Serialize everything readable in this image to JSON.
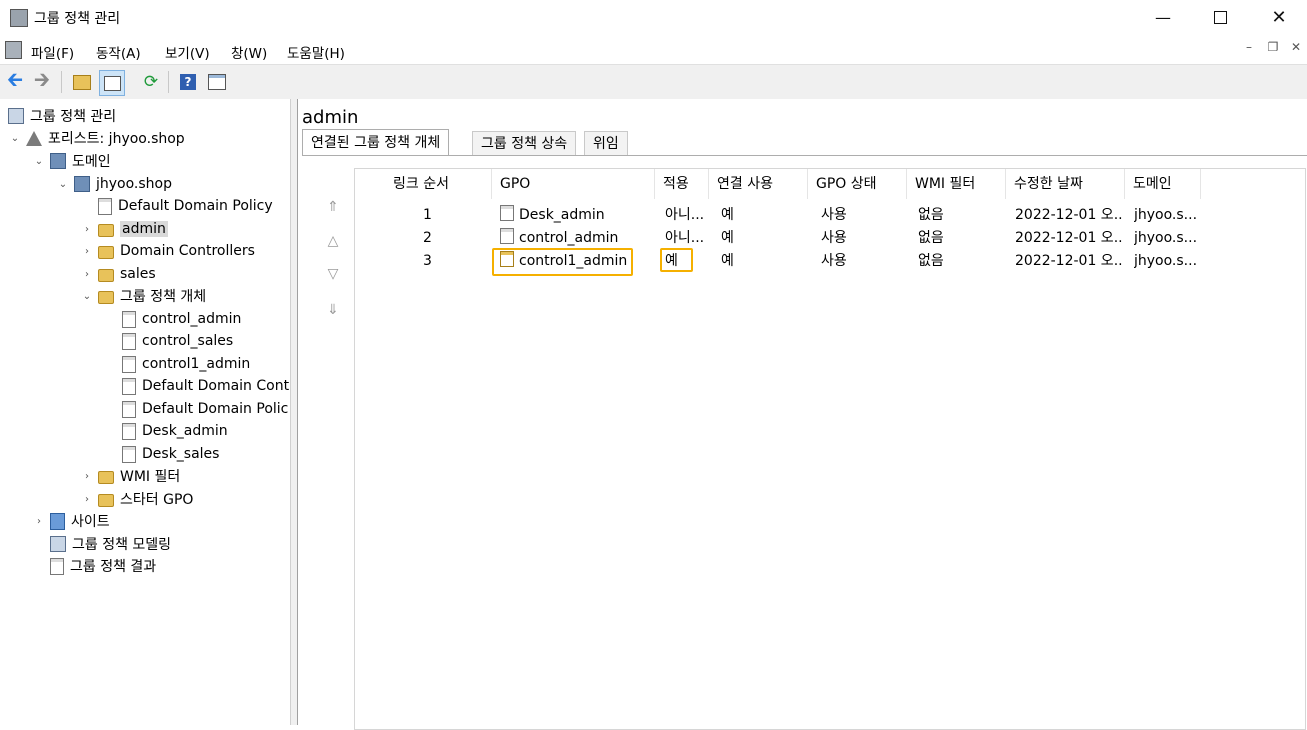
{
  "window": {
    "title": "그룹 정책 관리",
    "icon": "gpmc-app-icon",
    "controls": [
      "minimize-icon",
      "maximize-icon",
      "close-icon"
    ]
  },
  "menu": {
    "items": [
      "파일(F)",
      "동작(A)",
      "보기(V)",
      "창(W)",
      "도움말(H)"
    ],
    "mdi_controls": [
      "mdi-minimize-icon",
      "mdi-restore-icon",
      "mdi-close-icon"
    ]
  },
  "toolbar": {
    "buttons": [
      "back-arrow-icon",
      "forward-arrow-icon",
      "up-folder-icon",
      "show-hide-tree-icon",
      "refresh-icon",
      "help-icon",
      "properties-icon"
    ]
  },
  "tree": {
    "root": "그룹 정책 관리",
    "forest": "포리스트: jhyoo.shop",
    "domains": "도메인",
    "domain": "jhyoo.shop",
    "default_domain_policy": "Default Domain Policy",
    "ou_admin": "admin",
    "ou_dc": "Domain Controllers",
    "ou_sales": "sales",
    "gpo_container": "그룹 정책 개체",
    "gpo_items": [
      "control_admin",
      "control_sales",
      "control1_admin",
      "Default Domain Cont",
      "Default Domain Polic",
      "Desk_admin",
      "Desk_sales"
    ],
    "wmi_filters": "WMI 필터",
    "starter_gpo": "스타터 GPO",
    "sites": "사이트",
    "modeling": "그룹 정책 모델링",
    "results": "그룹 정책 결과"
  },
  "right": {
    "title": "admin",
    "tabs": [
      "연결된 그룹 정책 개체",
      "그룹 정책 상속",
      "위임"
    ],
    "columns": [
      "링크 순서",
      "GPO",
      "적용",
      "연결 사용",
      "GPO 상태",
      "WMI 필터",
      "수정한 날짜",
      "도메인"
    ],
    "rows": [
      {
        "order": "1",
        "gpo": "Desk_admin",
        "enforced": "아니...",
        "link_enabled": "예",
        "status": "사용",
        "wmi": "없음",
        "modified": "2022-12-01 오...",
        "domain": "jhyoo.s..."
      },
      {
        "order": "2",
        "gpo": "control_admin",
        "enforced": "아니...",
        "link_enabled": "예",
        "status": "사용",
        "wmi": "없음",
        "modified": "2022-12-01 오...",
        "domain": "jhyoo.s..."
      },
      {
        "order": "3",
        "gpo": "control1_admin",
        "enforced": "예",
        "link_enabled": "예",
        "status": "사용",
        "wmi": "없음",
        "modified": "2022-12-01 오...",
        "domain": "jhyoo.s..."
      }
    ],
    "highlight_color": "#f5b000"
  }
}
